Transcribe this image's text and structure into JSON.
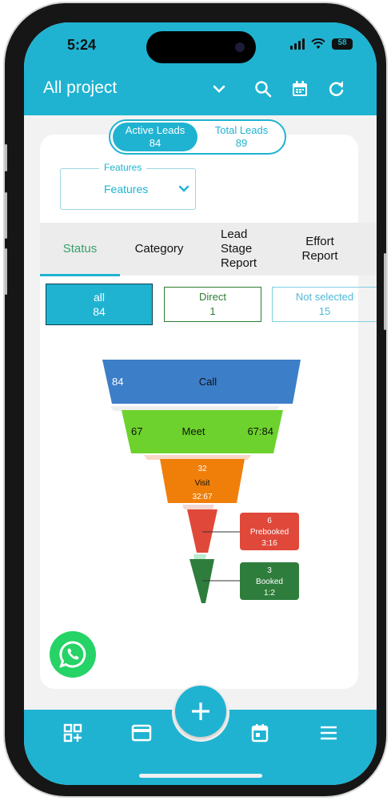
{
  "status_bar": {
    "time": "5:24",
    "battery": "58"
  },
  "app_bar": {
    "title": "All project"
  },
  "leads": {
    "active_label": "Active Leads",
    "active_count": "84",
    "total_label": "Total Leads",
    "total_count": "89"
  },
  "features": {
    "legend": "Features",
    "value": "Features"
  },
  "tabs": [
    {
      "label": "Status"
    },
    {
      "label": "Category"
    },
    {
      "label": "Lead\nStage\nReport"
    },
    {
      "label": "Effort\nReport"
    }
  ],
  "chips": {
    "all": {
      "label": "all",
      "count": "84"
    },
    "direct": {
      "label": "Direct",
      "count": "1"
    },
    "not_selected": {
      "label": "Not selected",
      "count": "15"
    }
  },
  "funnel": {
    "call": {
      "count": "84",
      "label": "Call"
    },
    "meet": {
      "count": "67",
      "label": "Meet",
      "ratio": "67:84"
    },
    "visit": {
      "count": "32",
      "label": "Visit",
      "ratio": "32:67"
    },
    "prebooked": {
      "count": "6",
      "label": "Prebooked",
      "ratio": "3:16"
    },
    "booked": {
      "count": "3",
      "label": "Booked",
      "ratio": "1:2"
    }
  },
  "colors": {
    "primary": "#1fb3d1",
    "call": "#3d7ec8",
    "meet": "#6dd22d",
    "visit": "#f07f0a",
    "prebooked": "#e0483a",
    "booked": "#2e7d3c",
    "whatsapp": "#25d366"
  },
  "icons": {
    "app_bar": [
      "chevron-down-icon",
      "search-icon",
      "calendar-icon",
      "refresh-icon"
    ],
    "bottom_nav": [
      "dashboard-add-icon",
      "card-icon",
      "add-icon",
      "calendar-icon",
      "menu-icon"
    ],
    "fab": "whatsapp-icon"
  }
}
